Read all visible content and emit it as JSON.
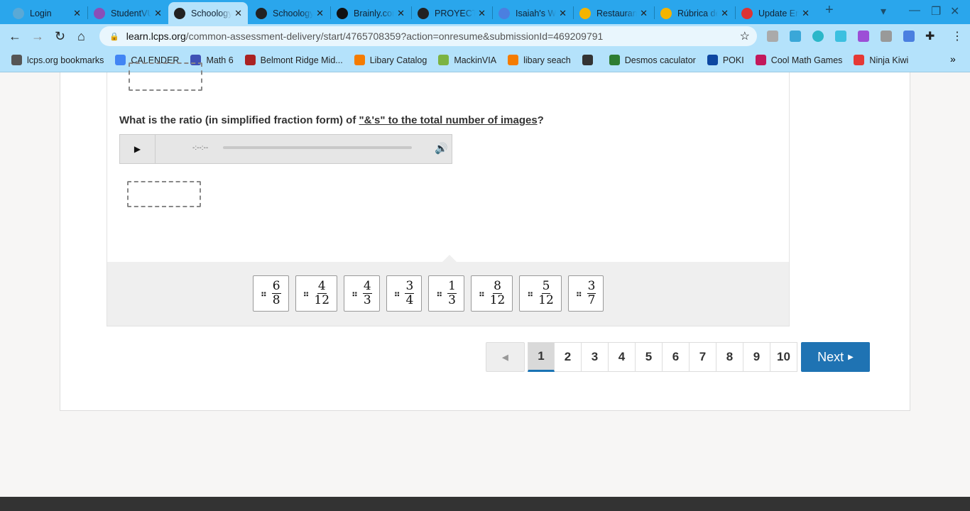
{
  "browser": {
    "tabs": [
      {
        "title": "Login",
        "color": "#5aa9d6"
      },
      {
        "title": "StudentVUE",
        "color": "#8a4fb8"
      },
      {
        "title": "Schoology",
        "color": "#222",
        "active": true
      },
      {
        "title": "Schoology",
        "color": "#222"
      },
      {
        "title": "Brainly.com",
        "color": "#111"
      },
      {
        "title": "PROYECTO",
        "color": "#222"
      },
      {
        "title": "Isaiah's Work",
        "color": "#4b7fe0"
      },
      {
        "title": "Restaurant",
        "color": "#f4b400"
      },
      {
        "title": "Rúbrica de",
        "color": "#f4b400"
      },
      {
        "title": "Update Email",
        "color": "#d33"
      }
    ],
    "url_host": "learn.lcps.org",
    "url_path": "/common-assessment-delivery/start/4765708359?action=onresume&submissionId=469209791",
    "bookmarks": [
      {
        "label": "lcps.org bookmarks",
        "color": "#555"
      },
      {
        "label": "CALENDER",
        "color": "#4285f4"
      },
      {
        "label": "Math 6",
        "color": "#3f51b5"
      },
      {
        "label": "Belmont Ridge Mid...",
        "color": "#a22"
      },
      {
        "label": "Libary Catalog",
        "color": "#f57c00"
      },
      {
        "label": "MackinVIA",
        "color": "#7cb342"
      },
      {
        "label": "libary seach",
        "color": "#f57c00"
      },
      {
        "label": "",
        "color": "#333"
      },
      {
        "label": "Desmos caculator",
        "color": "#2e7d32"
      },
      {
        "label": "POKI",
        "color": "#0d47a1"
      },
      {
        "label": "Cool Math Games",
        "color": "#c2185b"
      },
      {
        "label": "Ninja Kiwi",
        "color": "#e53935"
      }
    ]
  },
  "question": {
    "prefix": "What is the ratio (in simplified fraction form) of ",
    "underlined": "\"&'s\" to the total number of images",
    "suffix": "?",
    "audio_time": "-:--:--"
  },
  "answers": [
    {
      "n": "6",
      "d": "8"
    },
    {
      "n": "4",
      "d": "12"
    },
    {
      "n": "4",
      "d": "3"
    },
    {
      "n": "3",
      "d": "4"
    },
    {
      "n": "1",
      "d": "3"
    },
    {
      "n": "8",
      "d": "12"
    },
    {
      "n": "5",
      "d": "12"
    },
    {
      "n": "3",
      "d": "7"
    }
  ],
  "pager": {
    "pages": [
      "1",
      "2",
      "3",
      "4",
      "5",
      "6",
      "7",
      "8",
      "9",
      "10"
    ],
    "current": "1",
    "next_label": "Next"
  },
  "accent": "#1f73b3"
}
